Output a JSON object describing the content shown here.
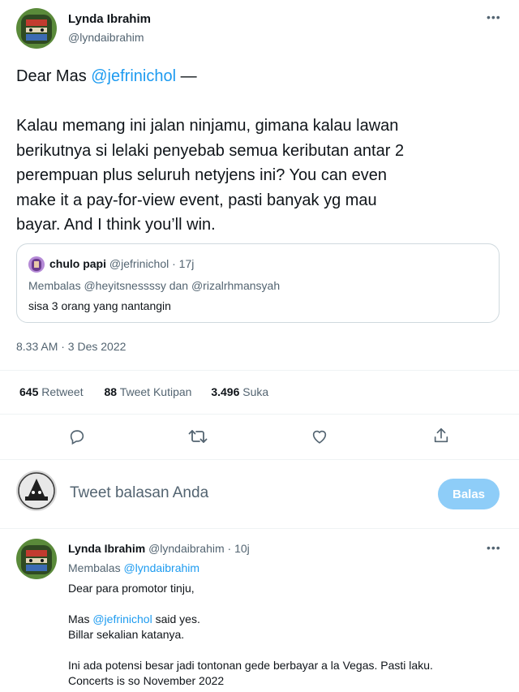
{
  "tweet": {
    "author_name": "Lynda Ibrahim",
    "author_handle": "@lyndaibrahim",
    "text_line0_prefix": "Dear Mas ",
    "text_line0_mention": "@jefrinichol",
    "text_line0_suffix": " —",
    "text_lines": [
      "Kalau memang ini jalan ninjamu, gimana kalau lawan",
      "berikutnya si lelaki penyebab semua keributan antar 2",
      "perempuan plus seluruh netyjens ini? You can even",
      "make it a pay-for-view event, pasti banyak yg mau",
      "bayar. And I think you’ll win."
    ],
    "timestamp": "8.33 AM · 3 Des 2022"
  },
  "quote": {
    "author_name": "chulo papi",
    "author_meta": "@jefrinichol · 17j",
    "reply_context": "Membalas @heyitsnessssy dan @rizalrhmansyah",
    "text": "sisa 3 orang yang nantangin"
  },
  "stats": {
    "retweets_count": "645",
    "retweets_label": "Retweet",
    "quotes_count": "88",
    "quotes_label": "Tweet Kutipan",
    "likes_count": "3.496",
    "likes_label": "Suka"
  },
  "actions": {
    "icons": [
      "reply-icon",
      "retweet-icon",
      "like-icon",
      "share-icon"
    ]
  },
  "composer": {
    "placeholder": "Tweet balasan Anda",
    "button_label": "Balas"
  },
  "reply": {
    "author_name": "Lynda Ibrahim",
    "author_meta": "@lyndaibrahim · 10j",
    "reply_prefix": "Membalas ",
    "reply_mention": "@lyndaibrahim",
    "line1": "Dear para promotor tinju,",
    "line2_prefix": "Mas ",
    "line2_mention": "@jefrinichol",
    "line2_suffix": " said yes.",
    "line3": "Billar sekalian katanya.",
    "line4": "Ini ada potensi besar jadi tontonan gede berbayar a la Vegas. Pasti laku.",
    "line5": "Concerts is so November 2022"
  },
  "colors": {
    "accent": "#1d9bf0",
    "muted": "#536471",
    "button_disabled": "#8ecdf8"
  }
}
